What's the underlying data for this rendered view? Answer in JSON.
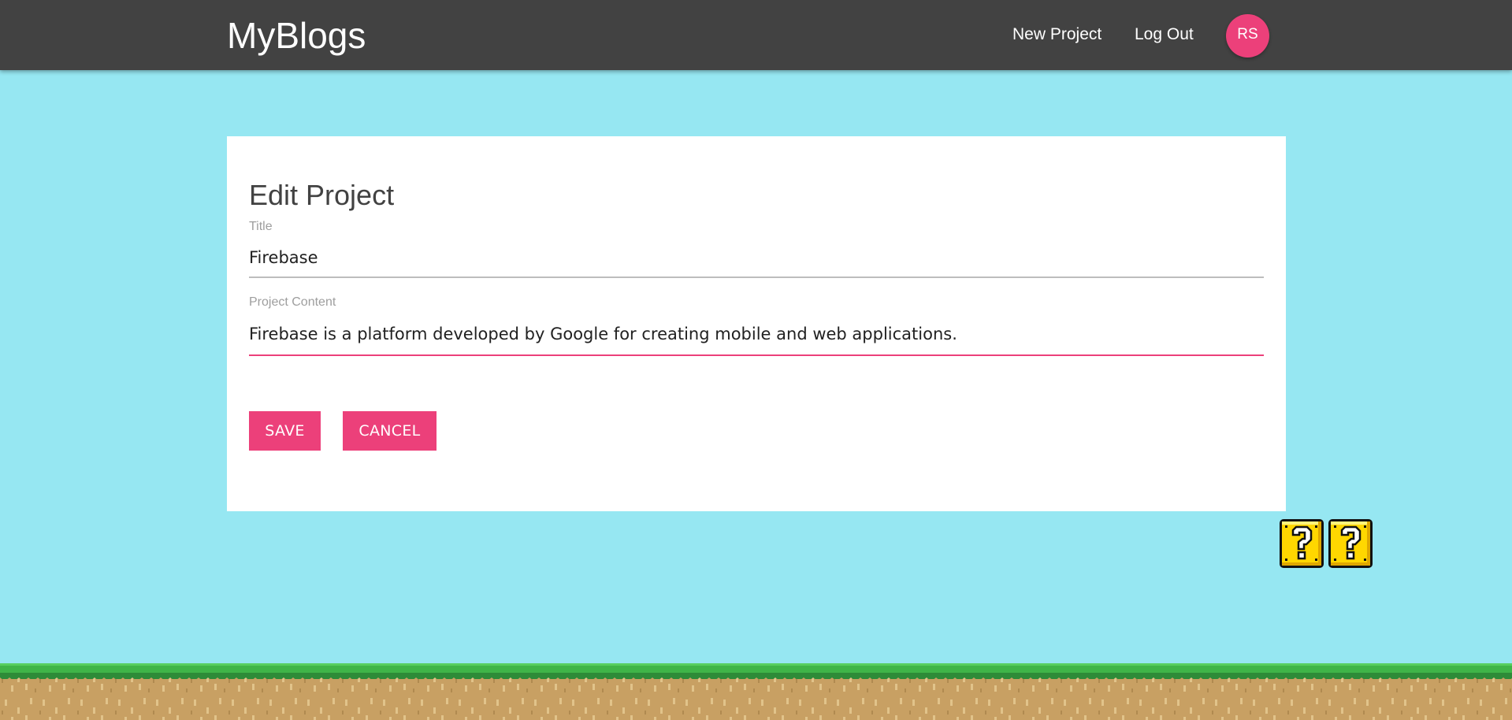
{
  "navbar": {
    "brand": "MyBlogs",
    "links": [
      {
        "label": "New Project"
      },
      {
        "label": "Log Out"
      }
    ],
    "avatar_initials": "RS"
  },
  "form": {
    "heading": "Edit Project",
    "title_label": "Title",
    "title_value": "Firebase",
    "content_label": "Project Content",
    "content_value": "Firebase is a platform developed by Google for creating mobile and web applications.",
    "save_label": "SAVE",
    "cancel_label": "CANCEL"
  },
  "decor": {
    "blocks": [
      {
        "icon": "question-block-icon"
      },
      {
        "icon": "question-block-icon"
      }
    ],
    "ground_icon": "grass-ground"
  },
  "colors": {
    "navbar": "#424242",
    "background": "#96e7f2",
    "accent": "#ec407a",
    "card": "#ffffff",
    "block_yellow": "#ffd700",
    "grass": "#3fb548",
    "dirt": "#c8a063"
  }
}
